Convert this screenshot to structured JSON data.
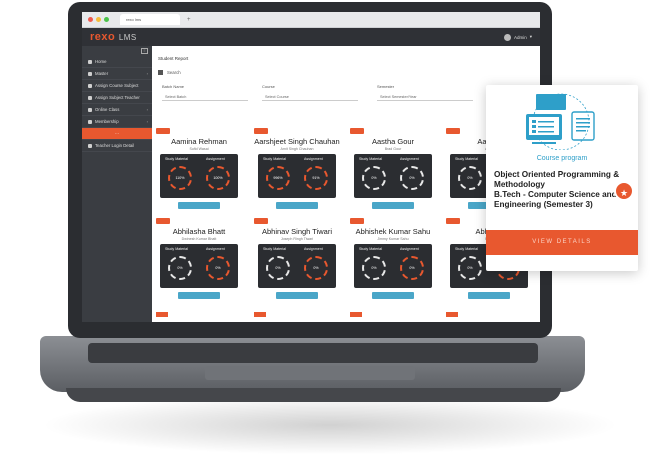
{
  "browser": {
    "tab_title": "rexo lms",
    "new_tab": "+"
  },
  "header": {
    "logo_main": "rexo",
    "logo_sub": "LMS",
    "user_name": "Admin",
    "user_caret": "▾"
  },
  "sidebar": {
    "toggle": "≡",
    "items": [
      {
        "label": "Home",
        "chevron": ""
      },
      {
        "label": "Master",
        "chevron": "›"
      },
      {
        "label": "Assign Course Subject",
        "chevron": ""
      },
      {
        "label": "Assign Subject Teacher",
        "chevron": ""
      },
      {
        "label": "Online Class",
        "chevron": "›"
      },
      {
        "label": "Membership",
        "chevron": "›"
      },
      {
        "label": "···",
        "chevron": ""
      },
      {
        "label": "Teacher Login Detail",
        "chevron": ""
      }
    ]
  },
  "content": {
    "title": "Student Report",
    "search_label": "Search",
    "filters": [
      {
        "label": "Batch Name",
        "placeholder": "Select Batch"
      },
      {
        "label": "Course",
        "placeholder": "Select Course"
      },
      {
        "label": "Semester",
        "placeholder": "Select Semester/Year"
      }
    ]
  },
  "students": [
    {
      "name": "Aamina Rehman",
      "sub": "Sufid Wasai",
      "sm": "110%",
      "as": "100%"
    },
    {
      "name": "Aarshjeet Singh Chauhan",
      "sub": "Amit Singh Chauhan",
      "sm": "996%",
      "as": "91%"
    },
    {
      "name": "Aastha Gour",
      "sub": "Brad Gour",
      "sm": "0%",
      "as": "0%"
    },
    {
      "name": "Aastha",
      "sub": "Allen",
      "sm": "0%",
      "as": "0%"
    },
    {
      "name": "Abhilasha Bhatt",
      "sub": "Dwinesh Kumar Bhatt",
      "sm": "0%",
      "as": "0%"
    },
    {
      "name": "Abhinav Singh Tiwari",
      "sub": "Joseph Ringh Tiwari",
      "sm": "0%",
      "as": "0%"
    },
    {
      "name": "Abhishek Kumar Sahu",
      "sub": "Jimmy Kumar Sahu",
      "sm": "0%",
      "as": "0%"
    },
    {
      "name": "Abhishe",
      "sub": "Ram",
      "sm": "0%",
      "as": "0%"
    }
  ],
  "card_labels": {
    "study_material": "Study Material",
    "assignment": "Assignment"
  },
  "course_card": {
    "label": "Course program",
    "title_line1": "Object Oriented Programming &",
    "title_line2": "Methodology",
    "title_line3": "B.Tech - Computer Science and",
    "title_line4": "Engineering (Semester 3)",
    "badge": "★",
    "view_button": "VIEW DETAILS"
  },
  "colors": {
    "accent": "#e8582f",
    "info": "#4aa6c8",
    "dark": "#2b2d31",
    "course_label": "#2e9fc9"
  }
}
